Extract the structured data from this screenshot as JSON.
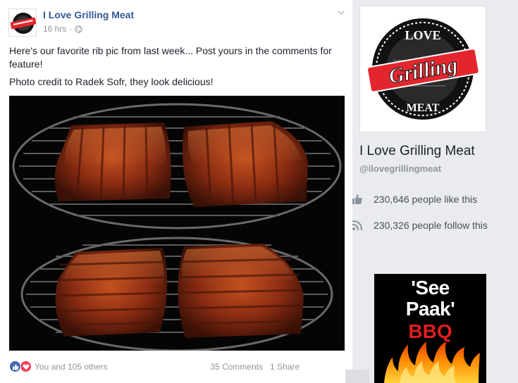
{
  "post": {
    "page_name": "I Love Grilling Meat",
    "time": "16 hrs",
    "separator": "·",
    "text_line1": "Here's our favorite rib pic from last week... Post yours in the comments for feature!",
    "text_line2": "Photo credit to Radek Sofr, they look delicious!",
    "reactions_text": "You and 105 others",
    "comments": "35 Comments",
    "shares": "1 Share"
  },
  "logo": {
    "top_text": "LOVE",
    "main_text": "Grilling",
    "bottom_text": "MEAT",
    "colors": {
      "red": "#e3262e",
      "black": "#111111"
    }
  },
  "sidebar": {
    "page_title": "I Love Grilling Meat",
    "handle": "@ilovegrillingmeat",
    "likes_text": "230,646 people like this",
    "follows_text": "230,326 people follow this"
  },
  "ad": {
    "line1": "'See",
    "line2": "Paak'",
    "line3": "BBQ"
  },
  "icons": [
    "globe-icon",
    "chevron-down-icon",
    "like-reaction-icon",
    "love-reaction-icon",
    "thumbs-up-icon",
    "rss-follow-icon"
  ],
  "colors": {
    "link_blue": "#365899",
    "meta_gray": "#90949c",
    "like_blue": "#4267b2",
    "love_red": "#f33e58"
  }
}
